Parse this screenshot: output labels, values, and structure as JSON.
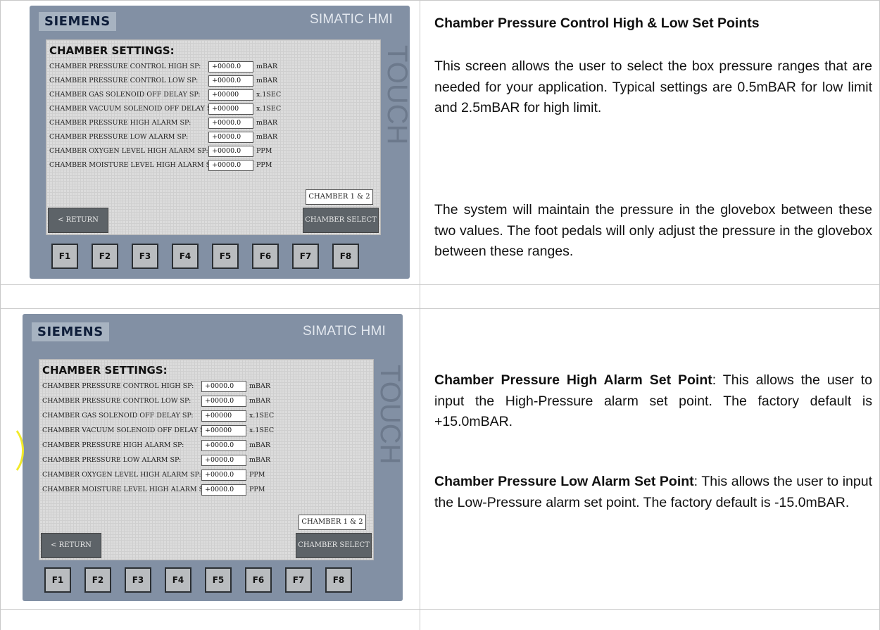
{
  "page_caption": "",
  "hmi": {
    "brand": "SIEMENS",
    "model": "SIMATIC HMI",
    "touch": "TOUCH",
    "screen_title": "CHAMBER SETTINGS:",
    "rows": [
      {
        "label": "CHAMBER PRESSURE CONTROL HIGH SP:",
        "value": "+0000.0",
        "unit": "mBAR"
      },
      {
        "label": "CHAMBER PRESSURE CONTROL LOW SP:",
        "value": "+0000.0",
        "unit": "mBAR"
      },
      {
        "label": "CHAMBER GAS SOLENOID OFF DELAY SP:",
        "value": "+00000",
        "unit": "x.1SEC"
      },
      {
        "label": "CHAMBER VACUUM SOLENOID OFF DELAY SP:",
        "value": "+00000",
        "unit": "x.1SEC"
      },
      {
        "label": "CHAMBER PRESSURE HIGH ALARM SP:",
        "value": "+0000.0",
        "unit": "mBAR"
      },
      {
        "label": "CHAMBER PRESSURE LOW ALARM SP:",
        "value": "+0000.0",
        "unit": "mBAR"
      },
      {
        "label": "CHAMBER OXYGEN LEVEL HIGH ALARM SP:",
        "value": "+0000.0",
        "unit": "PPM"
      },
      {
        "label": "CHAMBER MOISTURE LEVEL HIGH ALARM SP:",
        "value": "+0000.0",
        "unit": "PPM"
      }
    ],
    "chamber_selection": "CHAMBER 1 & 2",
    "return_label": "< RETURN",
    "chamber_select_label": "CHAMBER SELECT",
    "function_keys": [
      "F1",
      "F2",
      "F3",
      "F4",
      "F5",
      "F6",
      "F7",
      "F8"
    ]
  },
  "section1": {
    "heading": "Chamber Pressure Control High & Low Set Points",
    "para1": "This screen allows the user to select the box pressure ranges that are needed for your application. Typical settings are 0.5mBAR for low limit and 2.5mBAR for high limit.",
    "para2": "The system will maintain the pressure in the glovebox between these two values. The foot pedals will only adjust the pressure in the glovebox between these ranges."
  },
  "section2": {
    "high_term": "Chamber Pressure High Alarm Set Point",
    "high_text": ": This allows the user to input the High-Pressure alarm set point. The factory default is +15.0mBAR.",
    "low_term": "Chamber Pressure Low Alarm Set Point",
    "low_text": ": This allows the user to input the Low-Pressure alarm set point. The factory default is -15.0mBAR."
  },
  "colors": {
    "panel_bezel": "#8290a4",
    "screen_bg": "#dcdcdc",
    "button_dark": "#5d6368",
    "highlight_circle": "#f2ea2a"
  }
}
